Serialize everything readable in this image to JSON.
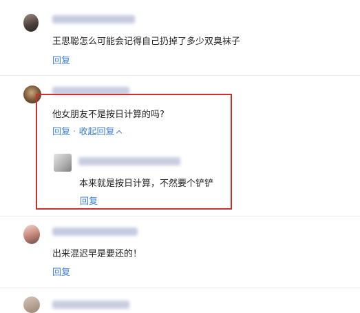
{
  "comments": [
    {
      "text": "王思聪怎么可能会记得自己扔掉了多少双臭袜子",
      "reply": "回复"
    },
    {
      "text": "他女朋友不是按日计算的吗?",
      "reply": "回复",
      "separator": "·",
      "collapse": "收起回复"
    },
    {
      "text": "出来混迟早是要还的！",
      "reply": "回复"
    }
  ],
  "sub_reply": {
    "text": "本来就是按日计算，不然要个铲铲",
    "reply": "回复"
  },
  "colors": {
    "link": "#3d7fd6",
    "highlight_border": "#c8312d",
    "divider": "#ececec"
  }
}
